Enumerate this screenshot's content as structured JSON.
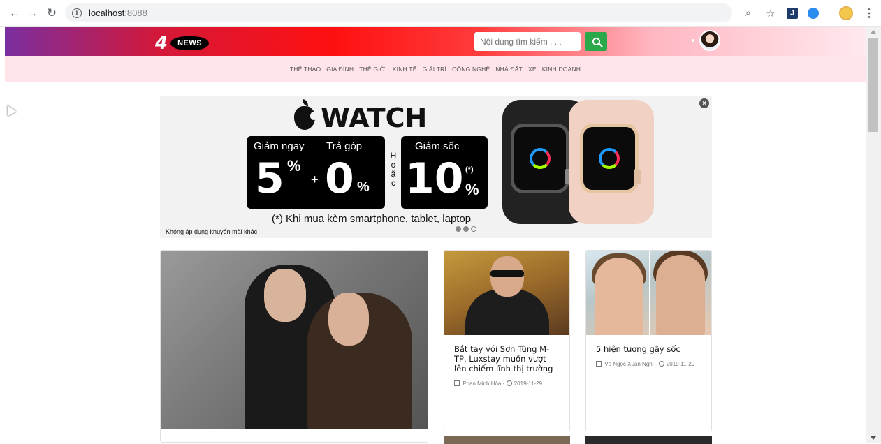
{
  "browser": {
    "url_host": "localhost",
    "url_port": ":8088",
    "back_icon": "arrow-left-icon",
    "forward_icon": "arrow-right-icon",
    "reload_icon": "reload-icon"
  },
  "header": {
    "logo_number": "4",
    "logo_badge": "NEWS",
    "search_placeholder": "Nội dung tìm kiếm . . .",
    "search_icon": "search-icon"
  },
  "categories": [
    "THỂ THAO",
    "GIA ĐÌNH",
    "THẾ GIỚI",
    "KINH TẾ",
    "GIẢI TRÍ",
    "CÔNG NGHỆ",
    "NHÀ ĐẤT",
    "XE",
    "KINH DOANH"
  ],
  "ad": {
    "title": "WATCH",
    "box1_head_a": "Giảm ngay",
    "box1_head_b": "Trả góp",
    "box1_big_a": "5",
    "box1_pct_a": "%",
    "box1_plus": "+",
    "box1_big_b": "0",
    "box1_pct_b": "%",
    "hoac": "H o ặ c",
    "box2_head": "Giảm sốc",
    "box2_big": "10",
    "box2_star": "(*)",
    "box2_pct": "%",
    "note": "(*) Khi mua kèm smartphone, tablet, laptop",
    "disclaimer": "Không áp dụng khuyến mãi khác",
    "close_label": "×"
  },
  "articles": [
    {
      "title": "Bắt tay với Sơn Tùng M-TP, Luxstay muốn vượt lên chiếm lĩnh thị trường",
      "author": "Phan Minh Hòa",
      "date": "2019-11-29"
    },
    {
      "title": "5 hiện tượng gây sốc",
      "author": "Võ Ngọc Xuân Nghi",
      "date": "2019-11-29"
    }
  ],
  "meta_separator": " - "
}
